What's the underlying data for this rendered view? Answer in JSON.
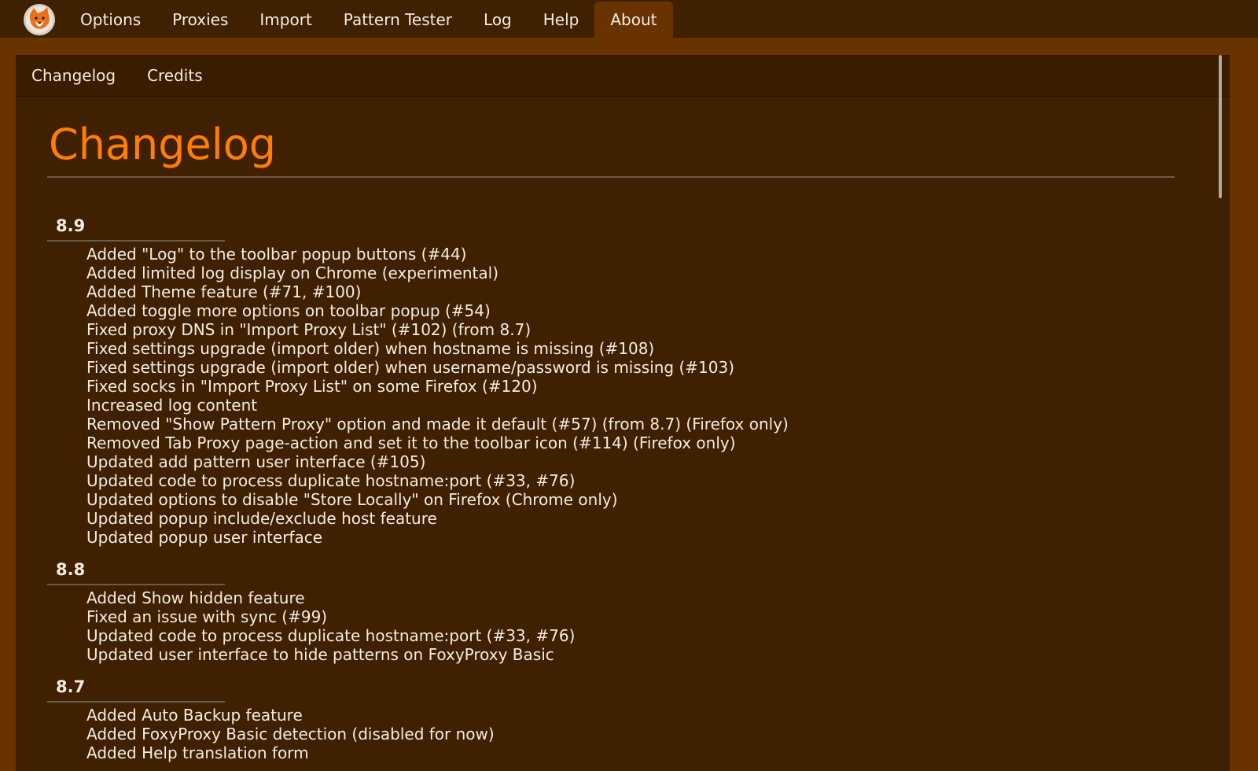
{
  "brand": {
    "logo_icon": "foxyproxy-fox-logo-icon",
    "accent_color": "#ff7d09",
    "background_color": "#3f2000",
    "page_color": "#683300"
  },
  "nav": {
    "items": [
      {
        "label": "Options",
        "active": false
      },
      {
        "label": "Proxies",
        "active": false
      },
      {
        "label": "Import",
        "active": false
      },
      {
        "label": "Pattern Tester",
        "active": false
      },
      {
        "label": "Log",
        "active": false
      },
      {
        "label": "Help",
        "active": false
      },
      {
        "label": "About",
        "active": true
      }
    ]
  },
  "subnav": {
    "items": [
      {
        "label": "Changelog"
      },
      {
        "label": "Credits"
      }
    ]
  },
  "main": {
    "title": "Changelog",
    "versions": [
      {
        "version": "8.9",
        "entries": [
          "Added \"Log\" to the toolbar popup buttons (#44)",
          "Added limited log display on Chrome (experimental)",
          "Added Theme feature (#71, #100)",
          "Added toggle more options on toolbar popup (#54)",
          "Fixed proxy DNS in \"Import Proxy List\" (#102) (from 8.7)",
          "Fixed settings upgrade (import older) when hostname is missing (#108)",
          "Fixed settings upgrade (import older) when username/password is missing (#103)",
          "Fixed socks in \"Import Proxy List\" on some Firefox (#120)",
          "Increased log content",
          "Removed \"Show Pattern Proxy\" option and made it default (#57) (from 8.7) (Firefox only)",
          "Removed Tab Proxy page-action and set it to the toolbar icon (#114) (Firefox only)",
          "Updated add pattern user interface (#105)",
          "Updated code to process duplicate hostname:port (#33, #76)",
          "Updated options to disable \"Store Locally\" on Firefox (Chrome only)",
          "Updated popup include/exclude host feature",
          "Updated popup user interface"
        ]
      },
      {
        "version": "8.8",
        "entries": [
          "Added Show hidden feature",
          "Fixed an issue with sync (#99)",
          "Updated code to process duplicate hostname:port (#33, #76)",
          "Updated user interface to hide patterns on FoxyProxy Basic"
        ]
      },
      {
        "version": "8.7",
        "entries": [
          "Added Auto Backup feature",
          "Added FoxyProxy Basic detection (disabled for now)",
          "Added Help translation form"
        ]
      }
    ]
  }
}
